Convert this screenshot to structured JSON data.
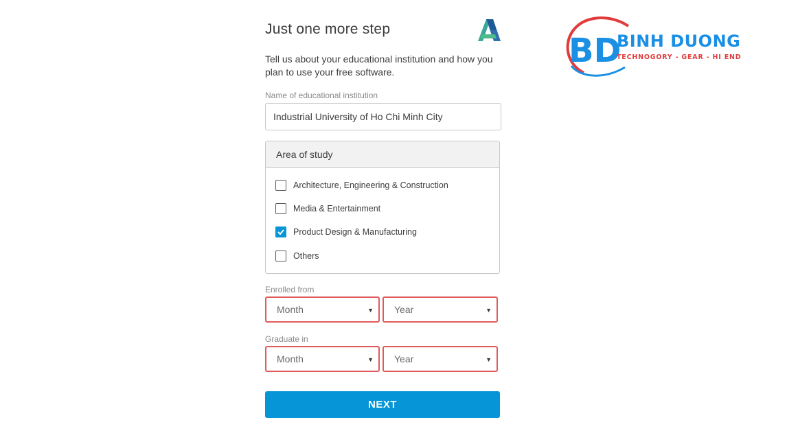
{
  "form": {
    "title": "Just one more step",
    "intro": "Tell us about your educational institution and how you plan to use your free software.",
    "institution": {
      "label": "Name of educational institution",
      "value": "Industrial University of Ho Chi Minh City"
    },
    "area_of_study": {
      "heading": "Area of study",
      "options": [
        {
          "label": "Architecture, Engineering & Construction",
          "checked": false
        },
        {
          "label": "Media & Entertainment",
          "checked": false
        },
        {
          "label": "Product Design & Manufacturing",
          "checked": true
        },
        {
          "label": "Others",
          "checked": false
        }
      ]
    },
    "enrolled_from": {
      "label": "Enrolled from",
      "month": "Month",
      "year": "Year"
    },
    "graduate_in": {
      "label": "Graduate in",
      "month": "Month",
      "year": "Year"
    },
    "next_label": "NEXT",
    "logo_icon": "autodesk-logo"
  },
  "watermark": {
    "initials": "BD",
    "name": "BINH DUONG",
    "tagline": "TECHNOGORY - GEAR - HI END"
  },
  "colors": {
    "accent": "#0696d7",
    "error_border": "#e05a5a",
    "watermark_blue": "#1a8fe3",
    "watermark_red": "#e23b3b"
  }
}
